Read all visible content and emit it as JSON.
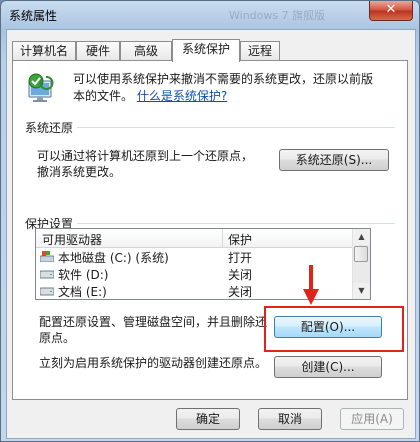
{
  "window": {
    "title": "系统属性",
    "ghost_title": "Windows 7 旗舰版",
    "close_label": "✕"
  },
  "tabs": [
    {
      "label": "计算机名",
      "active": false
    },
    {
      "label": "硬件",
      "active": false
    },
    {
      "label": "高级",
      "active": false
    },
    {
      "label": "系统保护",
      "active": true
    },
    {
      "label": "远程",
      "active": false
    }
  ],
  "intro": {
    "line1": "可以使用系统保护来撤消不需要的系统更改，还原以前版",
    "line2_prefix": "本的文件。",
    "link": "什么是系统保护?"
  },
  "system_restore": {
    "heading": "系统还原",
    "line1": "可以通过将计算机还原到上一个还原点，",
    "line2": "撤消系统更改。",
    "button": "系统还原(S)..."
  },
  "protection": {
    "heading": "保护设置",
    "col_drive": "可用驱动器",
    "col_protection": "保护",
    "drives": [
      {
        "name": "本地磁盘 (C:) (系统)",
        "protection": "打开",
        "icon": "system-drive-icon"
      },
      {
        "name": "软件 (D:)",
        "protection": "关闭",
        "icon": "drive-icon"
      },
      {
        "name": "文档 (E:)",
        "protection": "关闭",
        "icon": "drive-icon"
      }
    ],
    "configure_line1": "配置还原设置、管理磁盘空间，并且删除还",
    "configure_line2": "原点。",
    "configure_button": "配置(O)...",
    "create_text": "立刻为启用系统保护的驱动器创建还原点。",
    "create_button": "创建(C)..."
  },
  "footer": {
    "ok": "确定",
    "cancel": "取消",
    "apply": "应用(A)"
  },
  "annotation_color": "#e2231a"
}
